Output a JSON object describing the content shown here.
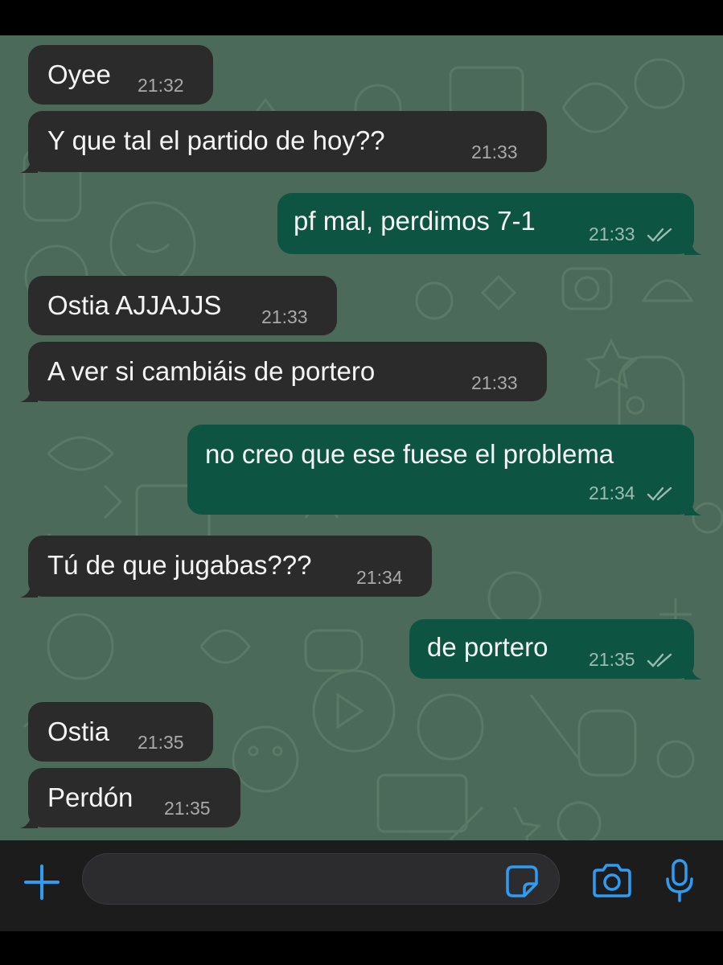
{
  "messages": [
    {
      "direction": "in",
      "text": "Oyee",
      "time": "21:32"
    },
    {
      "direction": "in",
      "text": "Y que tal el partido de hoy??",
      "time": "21:33"
    },
    {
      "direction": "out",
      "text": "pf mal, perdimos 7-1",
      "time": "21:33",
      "status": "read"
    },
    {
      "direction": "in",
      "text": "Ostia AJJAJJS",
      "time": "21:33"
    },
    {
      "direction": "in",
      "text": "A ver si cambiáis de portero",
      "time": "21:33"
    },
    {
      "direction": "out",
      "text": "no creo que ese fuese el problema",
      "time": "21:34",
      "status": "read"
    },
    {
      "direction": "in",
      "text": "Tú de que jugabas???",
      "time": "21:34"
    },
    {
      "direction": "out",
      "text": "de portero",
      "time": "21:35",
      "status": "read"
    },
    {
      "direction": "in",
      "text": "Ostia",
      "time": "21:35"
    },
    {
      "direction": "in",
      "text": "Perdón",
      "time": "21:35"
    }
  ],
  "composer": {
    "value": "",
    "placeholder": ""
  },
  "icons": {
    "add": "plus-icon",
    "sticker": "sticker-icon",
    "camera": "camera-icon",
    "microphone": "microphone-icon",
    "read_receipt": "double-check-icon"
  },
  "colors": {
    "wallpaper": "#4c6a59",
    "incoming_bubble": "#2b2b2c",
    "outgoing_bubble": "#0e5443",
    "accent": "#2f9cf4"
  }
}
